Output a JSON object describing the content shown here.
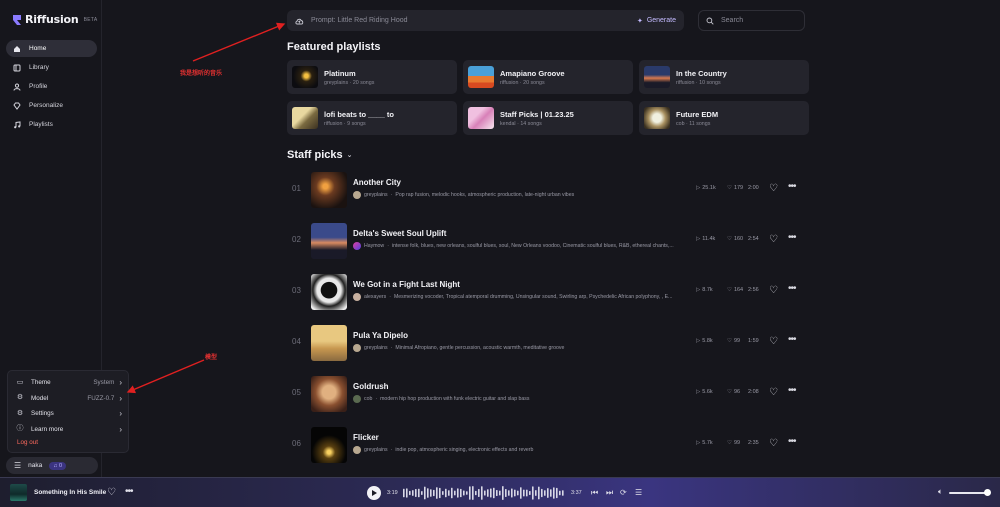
{
  "app": {
    "name": "Riffusion",
    "badge": "BETA"
  },
  "sidebar": {
    "items": [
      {
        "label": "Home",
        "icon": "home-icon",
        "active": true
      },
      {
        "label": "Library",
        "icon": "library-icon"
      },
      {
        "label": "Profile",
        "icon": "user-icon"
      },
      {
        "label": "Personalize",
        "icon": "diamond-icon"
      },
      {
        "label": "Playlists",
        "icon": "playlist-icon"
      }
    ]
  },
  "settings_menu": {
    "rows": [
      {
        "label": "Theme",
        "value": "System",
        "icon": "monitor-icon"
      },
      {
        "label": "Model",
        "value": "FUZZ-0.7",
        "icon": "chip-icon"
      },
      {
        "label": "Settings",
        "value": "",
        "icon": "gear-icon"
      },
      {
        "label": "Learn more",
        "value": "",
        "icon": "info-icon"
      }
    ],
    "logout": "Log out"
  },
  "user": {
    "name": "naka",
    "credits": "0"
  },
  "prompt": {
    "placeholder": "Prompt: Little Red Riding Hood",
    "generate": "Generate"
  },
  "search": {
    "placeholder": "Search"
  },
  "featured": {
    "heading": "Featured playlists",
    "playlists": [
      {
        "title": "Platinum",
        "sub": "greyplains · 20 songs"
      },
      {
        "title": "Amapiano Groove",
        "sub": "riffusion · 20 songs"
      },
      {
        "title": "In the Country",
        "sub": "riffusion · 10 songs"
      },
      {
        "title": "lofi beats to ____ to",
        "sub": "riffusion · 9 songs"
      },
      {
        "title": "Staff Picks | 01.23.25",
        "sub": "kendal · 14 songs"
      },
      {
        "title": "Future EDM",
        "sub": "cob · 11 songs"
      }
    ]
  },
  "staff": {
    "heading": "Staff picks",
    "songs": [
      {
        "num": "01",
        "title": "Another City",
        "author": "greyplains",
        "desc": "Pop rap fusion, melodic hooks, atmospheric production, late-night urban vibes",
        "plays": "25.1k",
        "likes": "179",
        "dur": "2:00"
      },
      {
        "num": "02",
        "title": "Delta's Sweet Soul Uplift",
        "author": "Haymow",
        "desc": "intense folk, blues, new orleans, soulful blues, soul, New Orleans voodoo, Cinematic soulful blues, R&B, ethereal chants,...",
        "plays": "11.4k",
        "likes": "160",
        "dur": "2:54"
      },
      {
        "num": "03",
        "title": "We Got in a Fight Last Night",
        "author": "alexayers",
        "desc": "Mesmerizing vocoder, Tropical atemporal drumming, Unsingular sound, Swirling arp, Psychedelic African polyphony, , E...",
        "plays": "8.7k",
        "likes": "164",
        "dur": "2:56"
      },
      {
        "num": "04",
        "title": "Pula Ya Dipelo",
        "author": "greyplains",
        "desc": "Minimal Afropiano, gentle percussion, acoustic warmth, meditative groove",
        "plays": "5.8k",
        "likes": "99",
        "dur": "1:59"
      },
      {
        "num": "05",
        "title": "Goldrush",
        "author": "cob",
        "desc": "modern hip hop production with funk electric guitar and slap bass",
        "plays": "5.6k",
        "likes": "96",
        "dur": "2:08"
      },
      {
        "num": "06",
        "title": "Flicker",
        "author": "greyplains",
        "desc": "indie pop, atmospheric singing, electronic effects and reverb",
        "plays": "5.7k",
        "likes": "99",
        "dur": "2:35"
      }
    ]
  },
  "annotations": {
    "music_label": "我是想听的音乐",
    "model_label": "模型"
  },
  "player": {
    "title": "Something In His Smile",
    "current": "3:19",
    "total": "3:37"
  }
}
